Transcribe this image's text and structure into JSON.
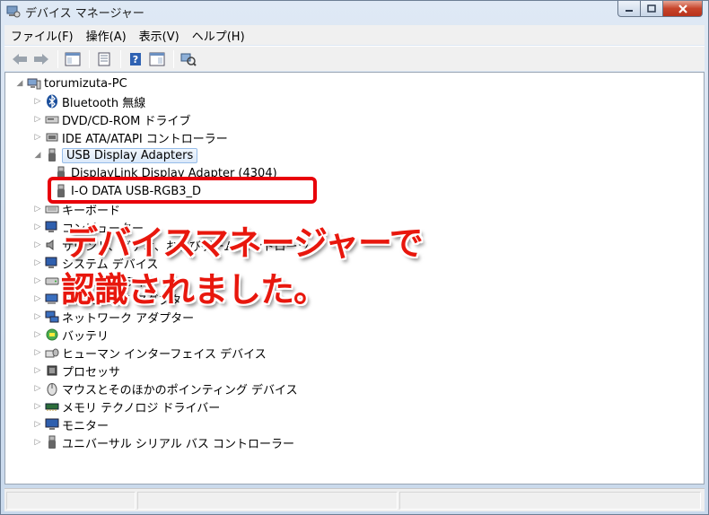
{
  "window": {
    "title": "デバイス マネージャー"
  },
  "menu": [
    "ファイル(F)",
    "操作(A)",
    "表示(V)",
    "ヘルプ(H)"
  ],
  "tree": {
    "root": "torumizuta-PC",
    "items": [
      {
        "label": "Bluetooth 無線",
        "icon": "bluetooth-icon"
      },
      {
        "label": "DVD/CD-ROM ドライブ",
        "icon": "disc-drive-icon"
      },
      {
        "label": "IDE ATA/ATAPI コントローラー",
        "icon": "ide-controller-icon"
      },
      {
        "label": "USB Display Adapters",
        "icon": "usb-icon",
        "expanded": true,
        "children": [
          "DisplayLink Display Adapter (4304)",
          "I-O DATA USB-RGB3_D"
        ]
      },
      {
        "label": "キーボード",
        "icon": "keyboard-icon"
      },
      {
        "label": "コンピューター",
        "icon": "computer-icon"
      },
      {
        "label": "サウンド、ビデオ、およびゲーム コントローラー",
        "icon": "speaker-icon"
      },
      {
        "label": "システム デバイス",
        "icon": "system-device-icon"
      },
      {
        "label": "ディスク ドライブ",
        "icon": "disk-drive-icon"
      },
      {
        "label": "ディスプレイ アダプター",
        "icon": "display-adapter-icon"
      },
      {
        "label": "ネットワーク アダプター",
        "icon": "network-icon"
      },
      {
        "label": "バッテリ",
        "icon": "battery-icon"
      },
      {
        "label": "ヒューマン インターフェイス デバイス",
        "icon": "hid-icon"
      },
      {
        "label": "プロセッサ",
        "icon": "processor-icon"
      },
      {
        "label": "マウスとそのほかのポインティング デバイス",
        "icon": "mouse-icon"
      },
      {
        "label": "メモリ テクノロジ ドライバー",
        "icon": "memory-icon"
      },
      {
        "label": "モニター",
        "icon": "monitor-icon"
      },
      {
        "label": "ユニバーサル シリアル バス コントローラー",
        "icon": "usb-controller-icon"
      }
    ]
  },
  "callout": {
    "line1": "デバイスマネージャーで",
    "line2": "認識されました。"
  },
  "colors": {
    "highlight": "#e8000a",
    "callout_text": "#e8170d"
  }
}
